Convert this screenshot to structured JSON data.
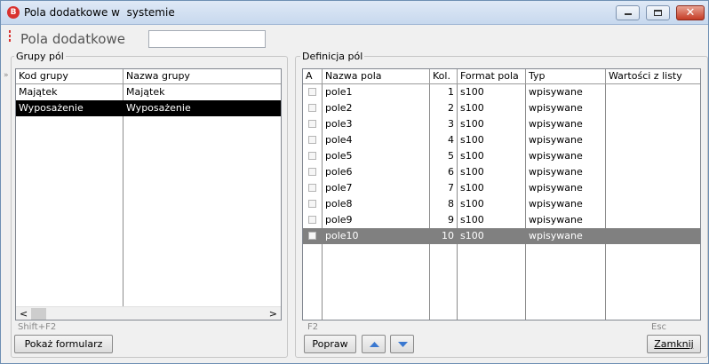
{
  "window": {
    "title": "Pola dodatkowe w  systemie",
    "app_icon_letter": "B",
    "close_glyph": "✕"
  },
  "header": {
    "title": "Pola dodatkowe",
    "input_value": ""
  },
  "left_group": {
    "legend": "Grupy pól",
    "columns": [
      "Kod grupy",
      "Nazwa grupy"
    ],
    "rows": [
      {
        "code": "Majątek",
        "name": "Majątek"
      },
      {
        "code": "Wyposażenie",
        "name": "Wyposażenie"
      }
    ],
    "selected_row": 1,
    "scroll_left": "<",
    "scroll_right": ">",
    "shortcut_hint": "Shift+F2",
    "show_form_button": "Pokaż formularz"
  },
  "right_group": {
    "legend": "Definicja pól",
    "columns": [
      "A",
      "Nazwa pola",
      "Kol.",
      "Format pola",
      "Typ",
      "Wartości z listy"
    ],
    "rows": [
      {
        "name": "pole1",
        "col": "1",
        "format": "s100",
        "type": "wpisywane",
        "values": ""
      },
      {
        "name": "pole2",
        "col": "2",
        "format": "s100",
        "type": "wpisywane",
        "values": ""
      },
      {
        "name": "pole3",
        "col": "3",
        "format": "s100",
        "type": "wpisywane",
        "values": ""
      },
      {
        "name": "pole4",
        "col": "4",
        "format": "s100",
        "type": "wpisywane",
        "values": ""
      },
      {
        "name": "pole5",
        "col": "5",
        "format": "s100",
        "type": "wpisywane",
        "values": ""
      },
      {
        "name": "pole6",
        "col": "6",
        "format": "s100",
        "type": "wpisywane",
        "values": ""
      },
      {
        "name": "pole7",
        "col": "7",
        "format": "s100",
        "type": "wpisywane",
        "values": ""
      },
      {
        "name": "pole8",
        "col": "8",
        "format": "s100",
        "type": "wpisywane",
        "values": ""
      },
      {
        "name": "pole9",
        "col": "9",
        "format": "s100",
        "type": "wpisywane",
        "values": ""
      },
      {
        "name": "pole10",
        "col": "10",
        "format": "s100",
        "type": "wpisywane",
        "values": ""
      }
    ],
    "selected_row": 9,
    "edit_hint": "F2",
    "edit_button": "Popraw",
    "move_up_icon": "arrow-up-icon",
    "move_down_icon": "arrow-down-icon",
    "esc_hint": "Esc",
    "close_button": "Zamknij"
  },
  "colors": {
    "accent_red": "#d9322f",
    "arrow_blue": "#3a78d0",
    "selected_black": "#000000",
    "selected_gray": "#808080"
  }
}
